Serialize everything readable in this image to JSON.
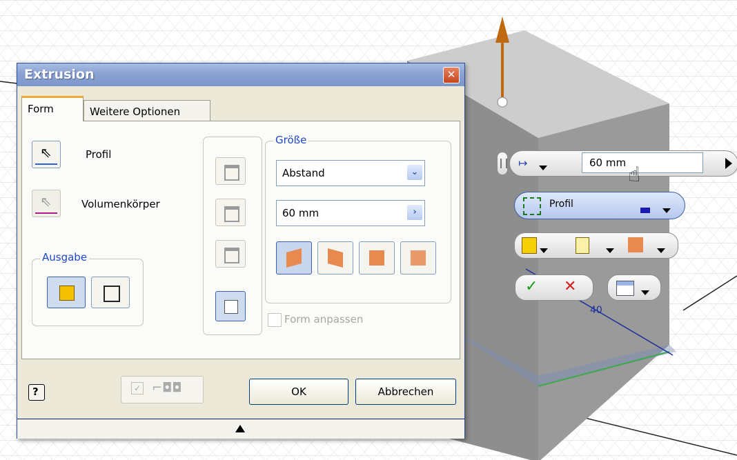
{
  "dialog": {
    "title": "Extrusion",
    "tabs": [
      {
        "label": "Form"
      },
      {
        "label": "Weitere Optionen"
      }
    ],
    "profile_label": "Profil",
    "solid_label": "Volumenkörper",
    "output_group_title": "Ausgabe",
    "size_group_title": "Größe",
    "extent_value": "Abstand",
    "distance_value": "60 mm",
    "match_shape_label": "Form anpassen",
    "ok_label": "OK",
    "cancel_label": "Abbrechen"
  },
  "minitoolbar": {
    "distance_value": "60 mm",
    "profile_label": "Profil"
  },
  "model": {
    "dimension_label": "40"
  },
  "colors": {
    "title_bar": "#8aa2d2",
    "accent_blue": "#1d48c8",
    "tab_highlight": "#f0a830",
    "close_button": "#d05a30",
    "ok_check": "#1a9a1a",
    "cancel_x": "#d02020",
    "arrow_orange": "#c06a10"
  },
  "icons": [
    "pointer-icon",
    "solid-pointer-icon",
    "solid-output-icon",
    "surface-output-icon",
    "dropdown-chevron-icon",
    "next-arrow-icon",
    "direction-1-icon",
    "direction-2-icon",
    "symmetric-icon",
    "asymmetric-icon",
    "help-icon",
    "glasses-icon",
    "hand-cursor-icon",
    "check-icon",
    "cancel-icon",
    "expand-arrow-icon"
  ]
}
